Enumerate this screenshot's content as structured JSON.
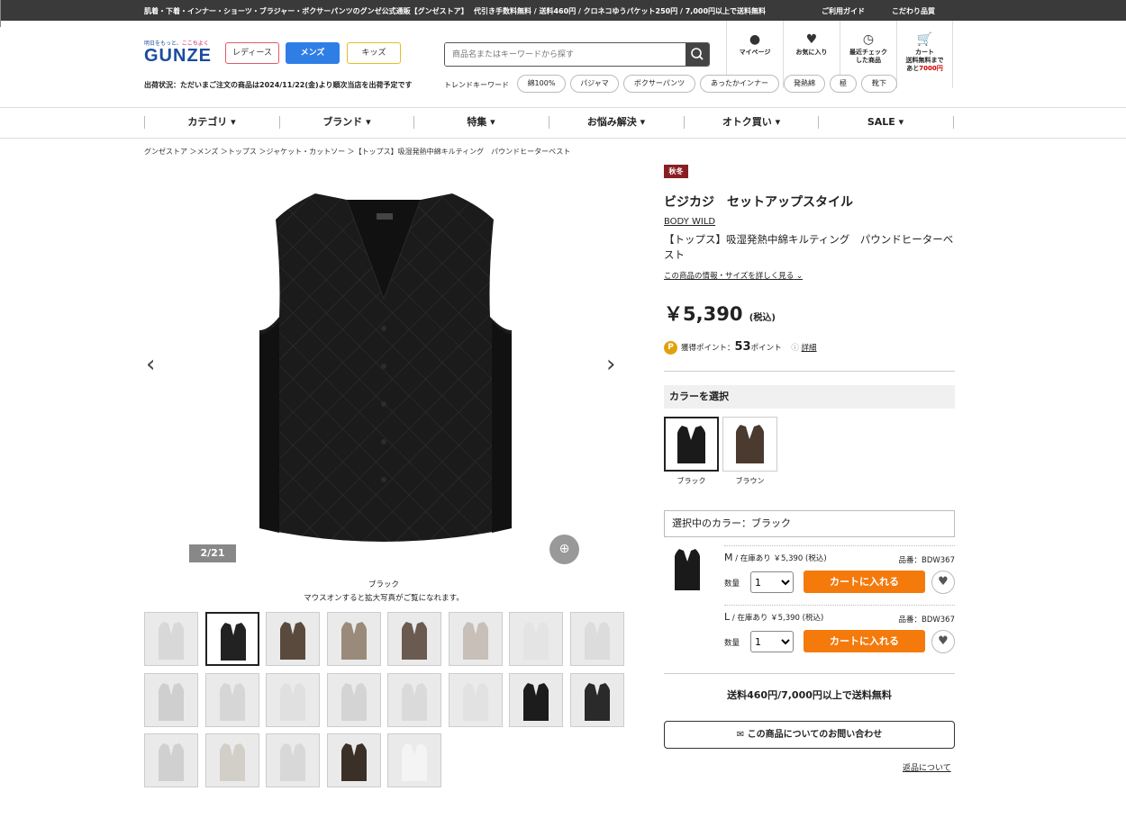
{
  "topbar": {
    "tagline": "肌着・下着・インナー・ショーツ・ブラジャー・ボクサーパンツのグンゼ公式通販【グンゼストア】",
    "promo": "代引き手数料無料 / 送料460円 / クロネコゆうパケット250円 / 7,000円以上で送料無料",
    "guide": "ご利用ガイド",
    "quality": "こだわり品質"
  },
  "logo": {
    "tag_a": "明日をもっと、",
    "tag_b": "ここちよく",
    "word": "GUNZE"
  },
  "categories": [
    {
      "label": "レディース",
      "color": "#e05a6a"
    },
    {
      "label": "メンズ",
      "color": "#2f7ee6"
    },
    {
      "label": "キッズ",
      "color": "#e0c020"
    }
  ],
  "search": {
    "placeholder": "商品名またはキーワードから探す"
  },
  "header_icons": [
    {
      "icon": "user-icon",
      "label": "マイページ"
    },
    {
      "icon": "heart-icon",
      "label": "お気に入り"
    },
    {
      "icon": "clock-icon",
      "label": "最近チェック",
      "label2": "した商品"
    },
    {
      "icon": "cart-icon",
      "label": "カート",
      "label2": "送料無料まで",
      "label3": "あと",
      "label3b": "7000円"
    }
  ],
  "shipping_status": "出荷状況：ただいまご注文の商品は2024/11/22(金)より順次当店を出荷予定です",
  "trend": {
    "label": "トレンドキーワード",
    "chips": [
      "綿100%",
      "パジャマ",
      "ボクサーパンツ",
      "あったかインナー",
      "発熱綿",
      "極",
      "靴下"
    ]
  },
  "gnav": [
    "カテゴリ",
    "ブランド",
    "特集",
    "お悩み解決",
    "オトク買い",
    "SALE"
  ],
  "breadcrumb": "グンゼストア ＞メンズ ＞トップス ＞ジャケット・カットソー ＞【トップス】吸湿発熱中綿キルティング　パウンドヒーターベスト",
  "gallery": {
    "counter": "2/21",
    "color_caption": "ブラック",
    "hover_caption": "マウスオンすると拡大写真がご覧になれます。",
    "thumb_count": 21,
    "selected_index": 2
  },
  "product": {
    "season": "秋冬",
    "style_title": "ビジカジ　セットアップスタイル",
    "brand": "BODY WILD",
    "name": "【トップス】吸湿発熱中綿キルティング　パウンドヒーターベスト",
    "info_link": "この商品の情報・サイズを詳しく見る",
    "price": "￥5,390",
    "tax": "(税込)",
    "points_label": "獲得ポイント：",
    "points_value": "53",
    "points_unit": "ポイント",
    "points_detail": "詳細"
  },
  "color_select": {
    "heading": "カラーを選択",
    "options": [
      {
        "label": "ブラック",
        "swatch": "#1a1a1a"
      },
      {
        "label": "ブラウン",
        "swatch": "#4a3a30"
      }
    ],
    "selected_text": "選択中のカラー：ブラック"
  },
  "sizes": [
    {
      "size": "M",
      "stock": "/ 在庫あり ￥5,390 (税込)",
      "code": "品番：BDW367",
      "qty_label": "数量",
      "qty": "1",
      "cart": "カートに入れる"
    },
    {
      "size": "L",
      "stock": "/ 在庫あり ￥5,390 (税込)",
      "code": "品番：BDW367",
      "qty_label": "数量",
      "qty": "1",
      "cart": "カートに入れる"
    }
  ],
  "free_shipping": "送料460円/7,000円以上で送料無料",
  "inquiry": "この商品についてのお問い合わせ",
  "returns": "返品について"
}
